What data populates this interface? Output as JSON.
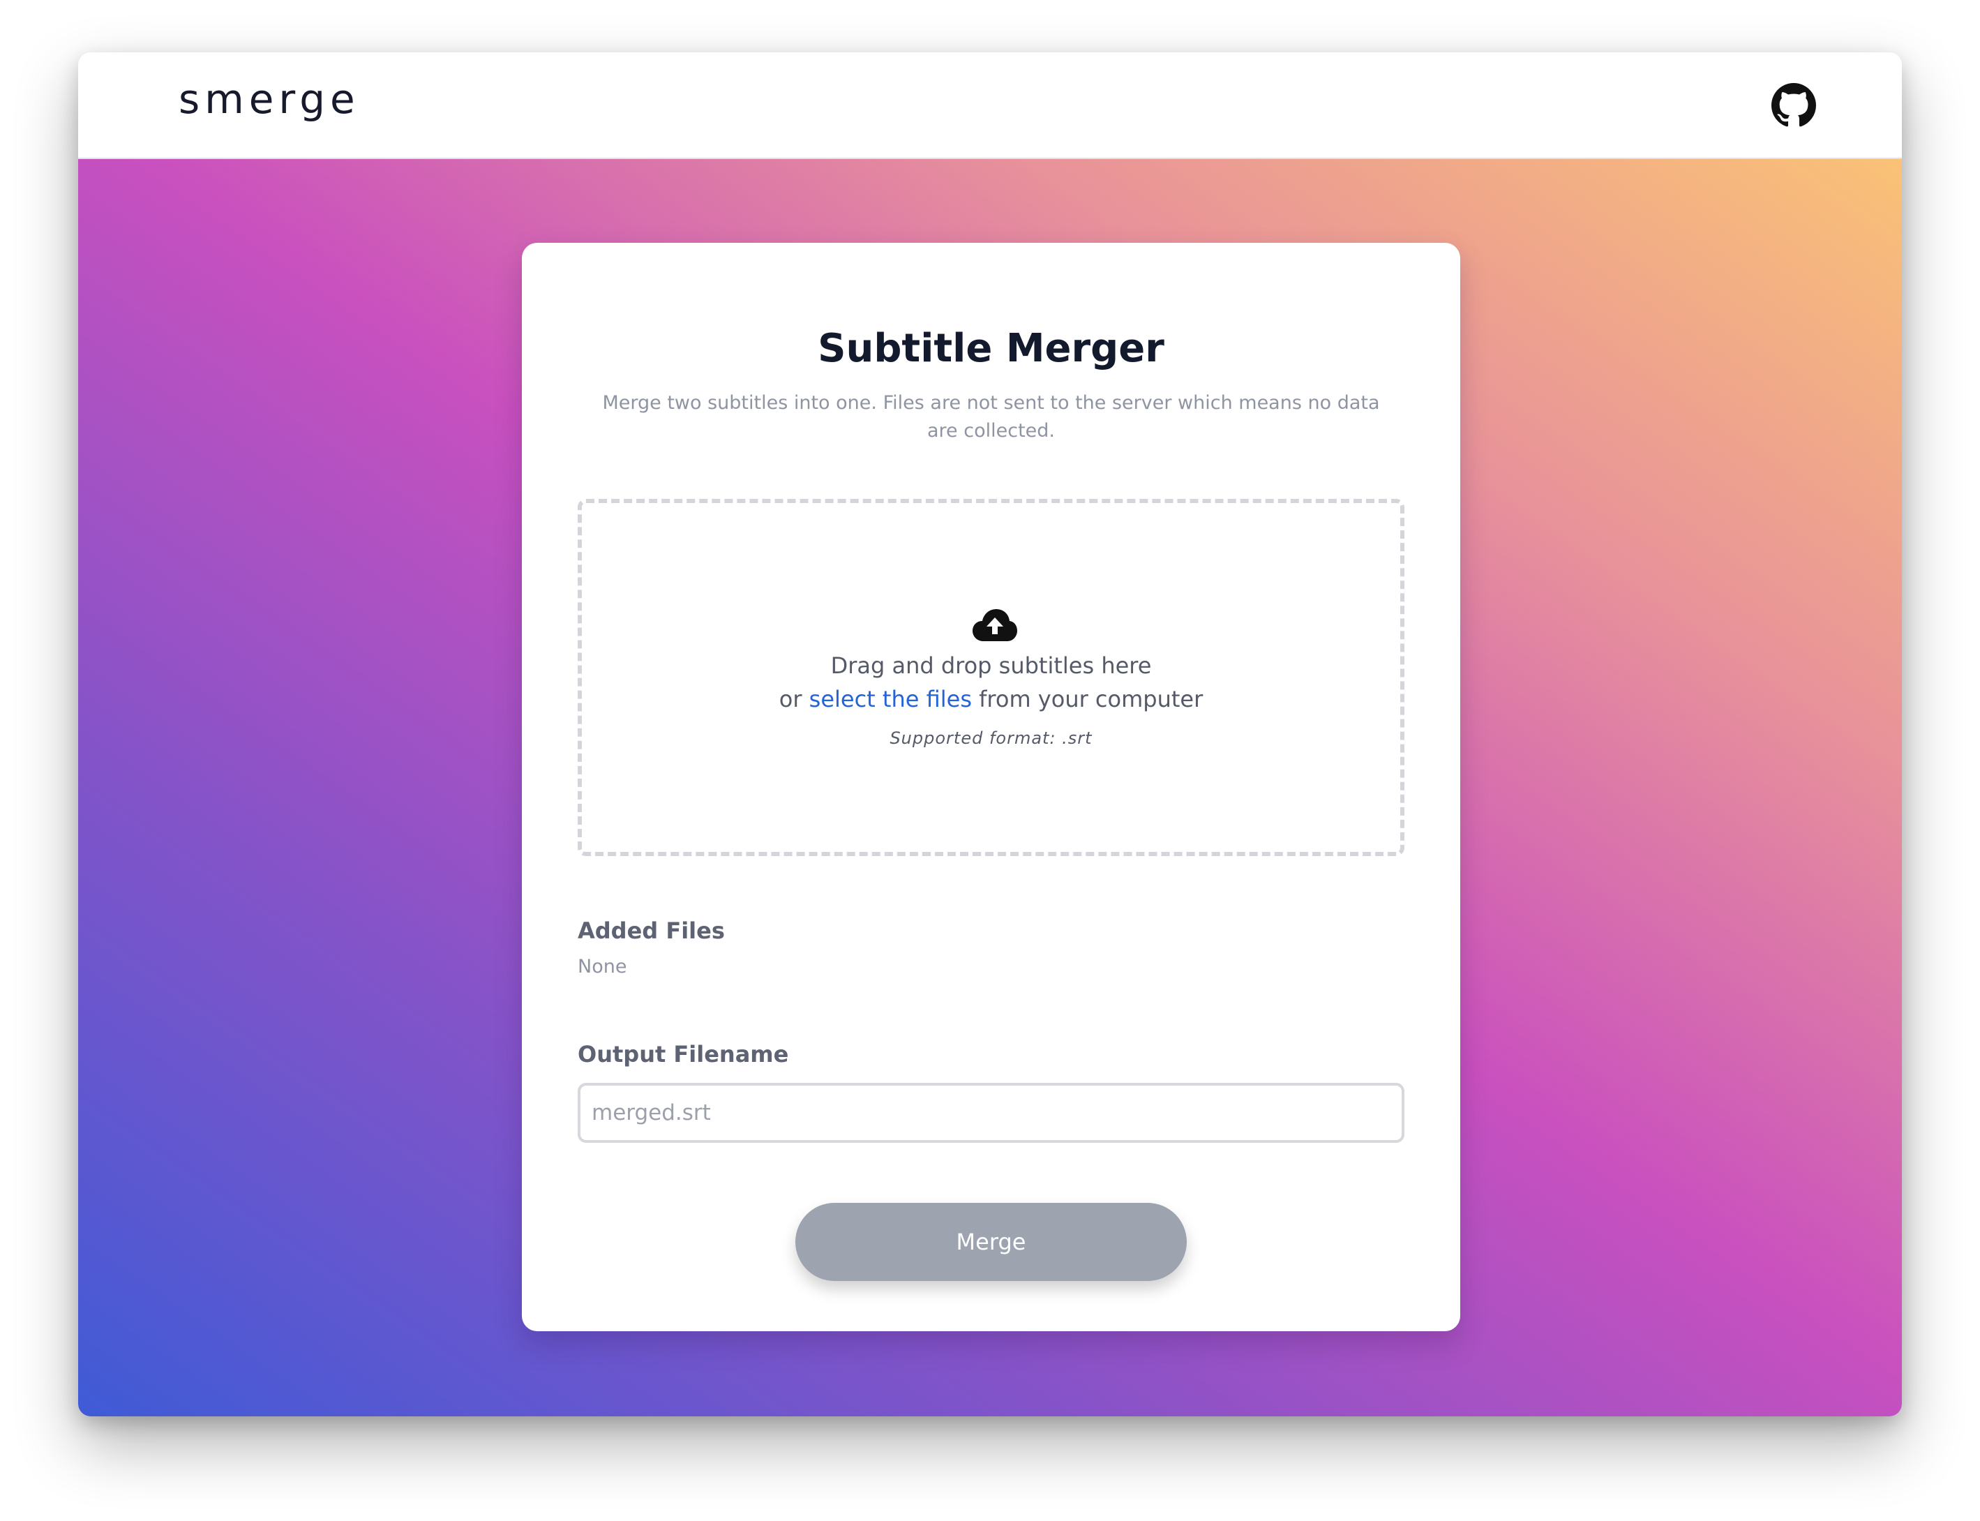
{
  "header": {
    "logo": "smerge",
    "icons": {
      "github": "github-icon"
    }
  },
  "card": {
    "title": "Subtitle Merger",
    "subtitle": "Merge two subtitles into one. Files are not sent to the server which means no data are collected."
  },
  "dropzone": {
    "icon": "cloud-upload-icon",
    "line1": "Drag and drop subtitles here",
    "line2_prefix": "or",
    "link_label": "select the files",
    "line2_suffix": "from your computer",
    "note": "Supported format: .srt"
  },
  "added_files": {
    "label": "Added Files",
    "value": "None"
  },
  "output": {
    "label": "Output Filename",
    "placeholder": "merged.srt"
  },
  "merge_button": {
    "label": "Merge"
  },
  "colors": {
    "link": "#2563d8",
    "button_disabled": "#9da3af",
    "gradient": [
      "#3f5bd6",
      "#8753c8",
      "#c950bf",
      "#e8929a",
      "#fac276"
    ]
  }
}
